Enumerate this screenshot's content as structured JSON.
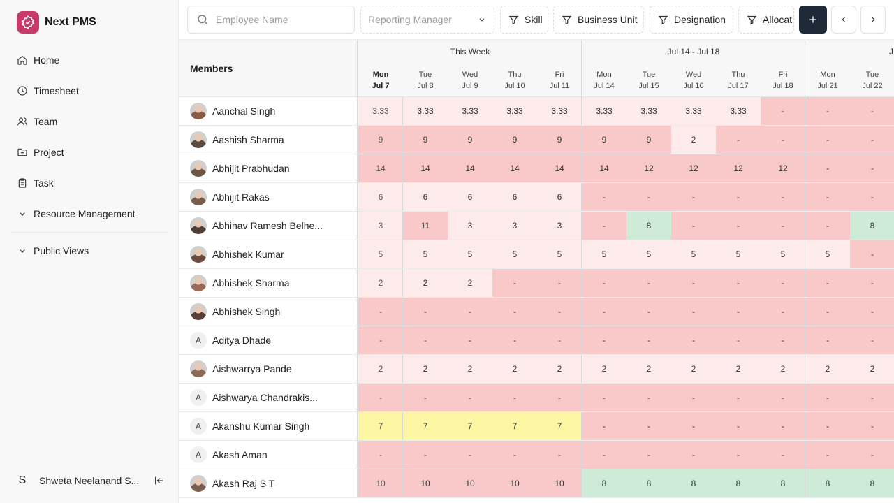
{
  "app": {
    "name": "Next PMS",
    "brand_color": "#c93a6a"
  },
  "nav": [
    {
      "label": "Home",
      "icon": "home-icon"
    },
    {
      "label": "Timesheet",
      "icon": "clock-icon"
    },
    {
      "label": "Team",
      "icon": "users-icon"
    },
    {
      "label": "Project",
      "icon": "folder-icon"
    },
    {
      "label": "Task",
      "icon": "clipboard-icon"
    }
  ],
  "nav_groups": [
    {
      "label": "Resource Management"
    },
    {
      "label": "Public Views"
    }
  ],
  "user": {
    "initial": "S",
    "name": "Shweta Neelanand S..."
  },
  "toolbar": {
    "search_placeholder": "Employee Name",
    "reporting_manager_placeholder": "Reporting Manager",
    "filters": [
      "Skill",
      "Business Unit",
      "Designation",
      "Allocat"
    ]
  },
  "grid": {
    "members_label": "Members",
    "weeks": [
      "This Week",
      "Jul 14 - Jul 18",
      "J"
    ],
    "days": [
      [
        "Mon",
        "Jul 7"
      ],
      [
        "Tue",
        "Jul 8"
      ],
      [
        "Wed",
        "Jul 9"
      ],
      [
        "Thu",
        "Jul 10"
      ],
      [
        "Fri",
        "Jul 11"
      ],
      [
        "Mon",
        "Jul 14"
      ],
      [
        "Tue",
        "Jul 15"
      ],
      [
        "Wed",
        "Jul 16"
      ],
      [
        "Thu",
        "Jul 17"
      ],
      [
        "Fri",
        "Jul 18"
      ],
      [
        "Mon",
        "Jul 21"
      ],
      [
        "Tue",
        "Jul 22"
      ]
    ],
    "rows": [
      {
        "name": "Aanchal Singh",
        "avatar": "photo",
        "values": [
          "3.33",
          "3.33",
          "3.33",
          "3.33",
          "3.33",
          "3.33",
          "3.33",
          "3.33",
          "3.33",
          "-",
          "-",
          "-"
        ],
        "colors": [
          "L",
          "L",
          "L",
          "L",
          "L",
          "L",
          "L",
          "L",
          "L",
          "P",
          "P",
          "P"
        ]
      },
      {
        "name": "Aashish Sharma",
        "avatar": "photo",
        "values": [
          "9",
          "9",
          "9",
          "9",
          "9",
          "9",
          "9",
          "2",
          "-",
          "-",
          "-",
          "-"
        ],
        "colors": [
          "P",
          "P",
          "P",
          "P",
          "P",
          "P",
          "P",
          "L",
          "P",
          "P",
          "P",
          "P"
        ]
      },
      {
        "name": "Abhijit Prabhudan",
        "avatar": "photo",
        "values": [
          "14",
          "14",
          "14",
          "14",
          "14",
          "14",
          "12",
          "12",
          "12",
          "12",
          "-",
          "-"
        ],
        "colors": [
          "P",
          "P",
          "P",
          "P",
          "P",
          "P",
          "P",
          "P",
          "P",
          "P",
          "P",
          "P"
        ]
      },
      {
        "name": "Abhijit Rakas",
        "avatar": "photo",
        "values": [
          "6",
          "6",
          "6",
          "6",
          "6",
          "-",
          "-",
          "-",
          "-",
          "-",
          "-",
          "-"
        ],
        "colors": [
          "L",
          "L",
          "L",
          "L",
          "L",
          "P",
          "P",
          "P",
          "P",
          "P",
          "P",
          "P"
        ]
      },
      {
        "name": "Abhinav Ramesh Belhe...",
        "avatar": "photo",
        "values": [
          "3",
          "11",
          "3",
          "3",
          "3",
          "-",
          "8",
          "-",
          "-",
          "-",
          "-",
          "8"
        ],
        "colors": [
          "L",
          "P",
          "L",
          "L",
          "L",
          "P",
          "G",
          "P",
          "P",
          "P",
          "P",
          "G"
        ]
      },
      {
        "name": "Abhishek Kumar",
        "avatar": "photo",
        "values": [
          "5",
          "5",
          "5",
          "5",
          "5",
          "5",
          "5",
          "5",
          "5",
          "5",
          "5",
          "-"
        ],
        "colors": [
          "L",
          "L",
          "L",
          "L",
          "L",
          "L",
          "L",
          "L",
          "L",
          "L",
          "L",
          "P"
        ]
      },
      {
        "name": "Abhishek Sharma",
        "avatar": "photo",
        "values": [
          "2",
          "2",
          "2",
          "-",
          "-",
          "-",
          "-",
          "-",
          "-",
          "-",
          "-",
          "-"
        ],
        "colors": [
          "L",
          "L",
          "L",
          "P",
          "P",
          "P",
          "P",
          "P",
          "P",
          "P",
          "P",
          "P"
        ]
      },
      {
        "name": "Abhishek Singh",
        "avatar": "photo",
        "values": [
          "-",
          "-",
          "-",
          "-",
          "-",
          "-",
          "-",
          "-",
          "-",
          "-",
          "-",
          "-"
        ],
        "colors": [
          "P",
          "P",
          "P",
          "P",
          "P",
          "P",
          "P",
          "P",
          "P",
          "P",
          "P",
          "P"
        ]
      },
      {
        "name": "Aditya Dhade",
        "avatar": "A",
        "values": [
          "-",
          "-",
          "-",
          "-",
          "-",
          "-",
          "-",
          "-",
          "-",
          "-",
          "-",
          "-"
        ],
        "colors": [
          "P",
          "P",
          "P",
          "P",
          "P",
          "P",
          "P",
          "P",
          "P",
          "P",
          "P",
          "P"
        ]
      },
      {
        "name": "Aishwarrya Pande",
        "avatar": "photo",
        "values": [
          "2",
          "2",
          "2",
          "2",
          "2",
          "2",
          "2",
          "2",
          "2",
          "2",
          "2",
          "2"
        ],
        "colors": [
          "L",
          "L",
          "L",
          "L",
          "L",
          "L",
          "L",
          "L",
          "L",
          "L",
          "L",
          "L"
        ]
      },
      {
        "name": "Aishwarya Chandrakis...",
        "avatar": "A",
        "values": [
          "-",
          "-",
          "-",
          "-",
          "-",
          "-",
          "-",
          "-",
          "-",
          "-",
          "-",
          "-"
        ],
        "colors": [
          "P",
          "P",
          "P",
          "P",
          "P",
          "P",
          "P",
          "P",
          "P",
          "P",
          "P",
          "P"
        ]
      },
      {
        "name": "Akanshu Kumar Singh",
        "avatar": "A",
        "values": [
          "7",
          "7",
          "7",
          "7",
          "7",
          "-",
          "-",
          "-",
          "-",
          "-",
          "-",
          "-"
        ],
        "colors": [
          "Y",
          "Y",
          "Y",
          "Y",
          "Y",
          "P",
          "P",
          "P",
          "P",
          "P",
          "P",
          "P"
        ]
      },
      {
        "name": "Akash Aman",
        "avatar": "A",
        "values": [
          "-",
          "-",
          "-",
          "-",
          "-",
          "-",
          "-",
          "-",
          "-",
          "-",
          "-",
          "-"
        ],
        "colors": [
          "P",
          "P",
          "P",
          "P",
          "P",
          "P",
          "P",
          "P",
          "P",
          "P",
          "P",
          "P"
        ]
      },
      {
        "name": "Akash Raj S T",
        "avatar": "photo",
        "values": [
          "10",
          "10",
          "10",
          "10",
          "10",
          "8",
          "8",
          "8",
          "8",
          "8",
          "8",
          "8"
        ],
        "colors": [
          "P",
          "P",
          "P",
          "P",
          "P",
          "G",
          "G",
          "G",
          "G",
          "G",
          "G",
          "G"
        ]
      }
    ]
  },
  "colors": {
    "P": "#f9c8c9",
    "L": "#fdeaea",
    "G": "#cdebd6",
    "Y": "#fdf6a3"
  }
}
